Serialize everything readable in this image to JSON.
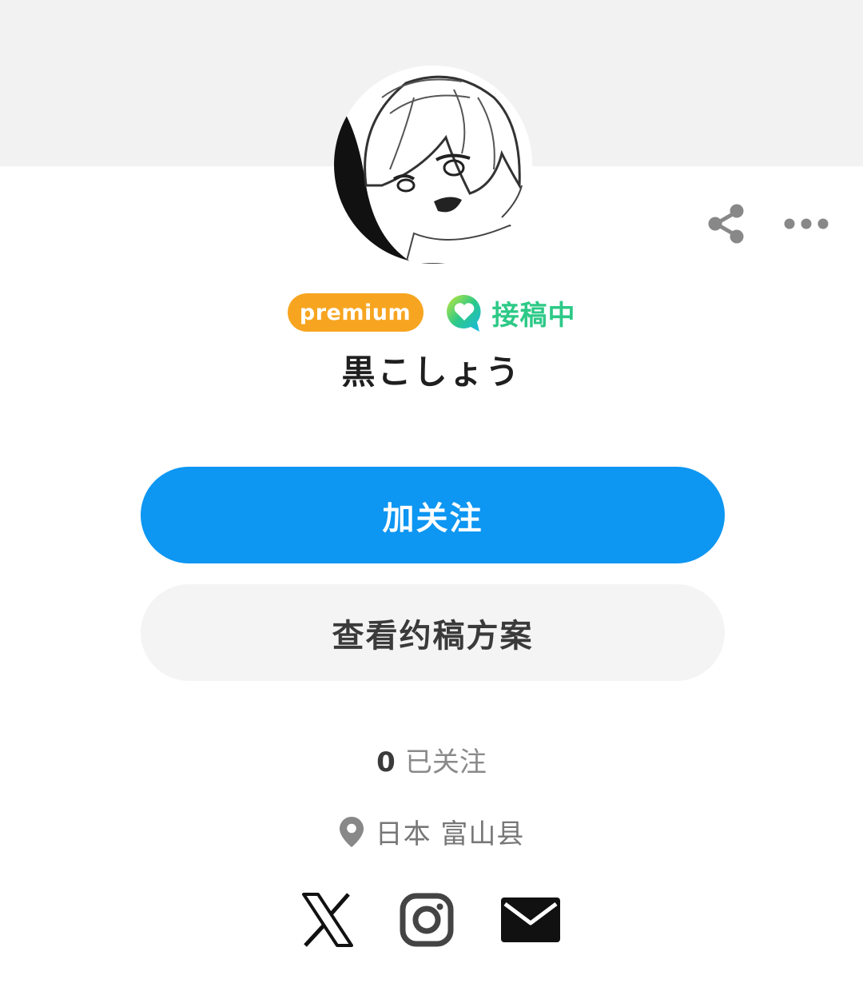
{
  "profile": {
    "premium_label": "premium",
    "commission_status": "接稿中",
    "username": "黒こしょう",
    "following_count": "0",
    "following_label": "已关注",
    "location": "日本 富山县"
  },
  "actions": {
    "follow_label": "加关注",
    "view_plans_label": "查看约稿方案"
  },
  "header_icons": [
    "share-icon",
    "more-icon"
  ],
  "social_icons": [
    "x-icon",
    "instagram-icon",
    "mail-icon"
  ],
  "colors": {
    "primary": "#0d96f2",
    "premium": "#f7a520",
    "commission": "#2dc987",
    "cover_bg": "#f2f2f2",
    "secondary_button_bg": "#f4f4f4"
  }
}
